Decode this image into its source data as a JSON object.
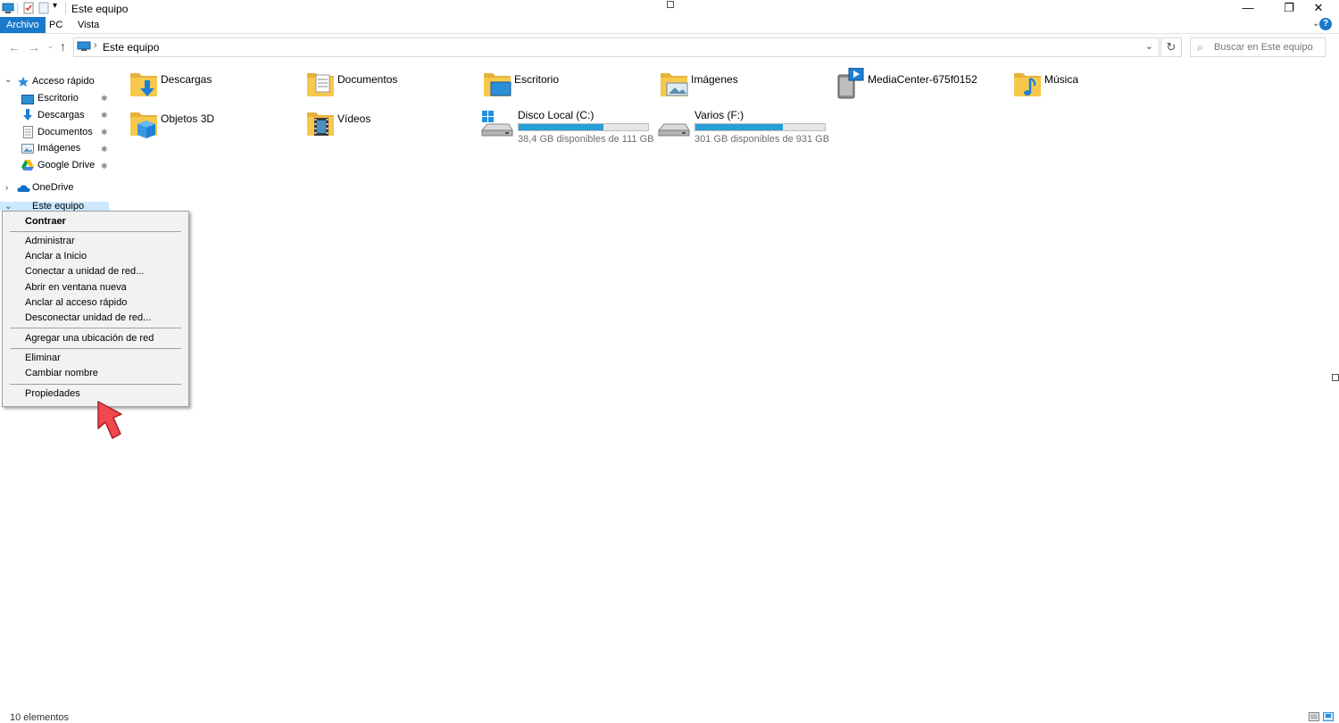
{
  "window": {
    "title": "Este equipo",
    "minimize_glyph": "—",
    "maximize_glyph": "❐",
    "close_glyph": "✕"
  },
  "ribbon": {
    "tabs": [
      {
        "label": "Archivo",
        "active": true
      },
      {
        "label": "PC",
        "active": false
      },
      {
        "label": "Vista",
        "active": false
      }
    ]
  },
  "address": {
    "path": "Este equipo",
    "dropdown_glyph": "⌄",
    "refresh_glyph": "↻"
  },
  "search": {
    "placeholder": "Buscar en Este equipo"
  },
  "sidebar": {
    "quick_access": "Acceso rápido",
    "items": [
      {
        "label": "Escritorio",
        "icon": "desktop-icon"
      },
      {
        "label": "Descargas",
        "icon": "download-icon"
      },
      {
        "label": "Documentos",
        "icon": "document-icon"
      },
      {
        "label": "Imágenes",
        "icon": "pictures-icon"
      },
      {
        "label": "Google Drive",
        "icon": "google-drive-icon"
      }
    ],
    "onedrive": "OneDrive",
    "this_pc": "Este equipo"
  },
  "content": {
    "folders": [
      {
        "label": "Descargas",
        "icon": "downloads-folder-icon"
      },
      {
        "label": "Documentos",
        "icon": "documents-folder-icon"
      },
      {
        "label": "Escritorio",
        "icon": "desktop-folder-icon"
      },
      {
        "label": "Imágenes",
        "icon": "pictures-folder-icon"
      },
      {
        "label": "MediaCenter-675f0152",
        "icon": "media-server-icon"
      },
      {
        "label": "Música",
        "icon": "music-folder-icon"
      },
      {
        "label": "Objetos 3D",
        "icon": "3d-objects-folder-icon"
      },
      {
        "label": "Vídeos",
        "icon": "videos-folder-icon"
      }
    ],
    "drives": [
      {
        "label": "Disco Local (C:)",
        "free": "38,4 GB disponibles de 111 GB",
        "used_fraction": 0.654
      },
      {
        "label": "Varios (F:)",
        "free": "301 GB disponibles de 931 GB",
        "used_fraction": 0.677
      }
    ]
  },
  "context_menu": {
    "items": [
      "Contraer",
      "Administrar",
      "Anclar a Inicio",
      "Conectar a unidad de red...",
      "Abrir en ventana nueva",
      "Anclar al acceso rápido",
      "Desconectar unidad de red...",
      "Agregar una ubicación de red",
      "Eliminar",
      "Cambiar nombre",
      "Propiedades"
    ]
  },
  "status": {
    "count": "10 elementos"
  },
  "colors": {
    "accent": "#1979ca",
    "drive_bar": "#26a0da",
    "folder": "#f6c94c",
    "annotation_arrow": "#f0484c"
  }
}
